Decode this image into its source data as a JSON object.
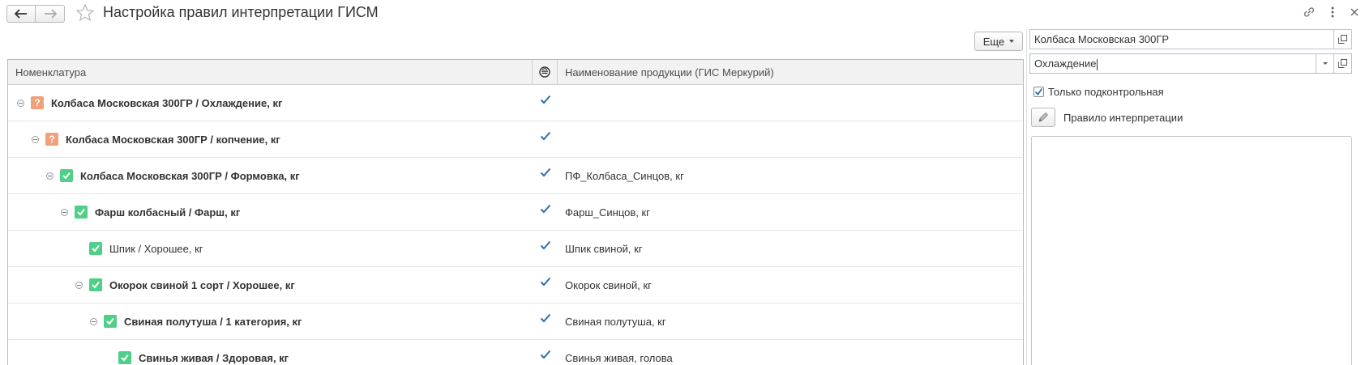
{
  "header": {
    "title": "Настройка правил интерпретации ГИСМ"
  },
  "toolbar": {
    "more_label": "Еще"
  },
  "table": {
    "columns": {
      "nomenclature": "Номенклатура",
      "mark_icon": "mercury-icon",
      "product_name": "Наименование продукции (ГИС Меркурий)"
    },
    "rows": [
      {
        "label": "Колбаса Московская 300ГР / Охлаждение, кг",
        "product": "",
        "status": "question",
        "bold": true,
        "level": 0,
        "expandable": true,
        "checked": true
      },
      {
        "label": "Колбаса Московская 300ГР / копчение, кг",
        "product": "",
        "status": "question",
        "bold": true,
        "level": 1,
        "expandable": true,
        "checked": true
      },
      {
        "label": "Колбаса Московская 300ГР / Формовка, кг",
        "product": "ПФ_Колбаса_Синцов, кг",
        "status": "ok",
        "bold": true,
        "level": 2,
        "expandable": true,
        "checked": true
      },
      {
        "label": "Фарш колбасный / Фарш, кг",
        "product": "Фарш_Синцов, кг",
        "status": "ok",
        "bold": true,
        "level": 3,
        "expandable": true,
        "checked": true
      },
      {
        "label": "Шпик / Хорошее, кг",
        "product": "Шпик свиной, кг",
        "status": "ok",
        "bold": false,
        "level": 4,
        "expandable": false,
        "checked": true
      },
      {
        "label": "Окорок свиной 1 сорт / Хорошее, кг",
        "product": "Окорок свиной, кг",
        "status": "ok",
        "bold": true,
        "level": 4,
        "expandable": true,
        "checked": true
      },
      {
        "label": "Свиная полутуша / 1 категория, кг",
        "product": "Свиная полутуша, кг",
        "status": "ok",
        "bold": true,
        "level": 5,
        "expandable": true,
        "checked": true
      },
      {
        "label": "Свинья живая / Здоровая, кг",
        "product": "Свинья живая, голова",
        "status": "ok",
        "bold": true,
        "level": 6,
        "expandable": false,
        "checked": true
      }
    ]
  },
  "right_panel": {
    "product_field": "Колбаса Московская 300ГР",
    "characteristic_field": "Охлаждение",
    "only_controlled_label": "Только подконтрольная",
    "only_controlled_checked": true,
    "rule_label": "Правило интерпретации"
  },
  "colors": {
    "question": "#f0a07a",
    "ok": "#4fcf88",
    "checkmark": "#2a6fb5"
  }
}
